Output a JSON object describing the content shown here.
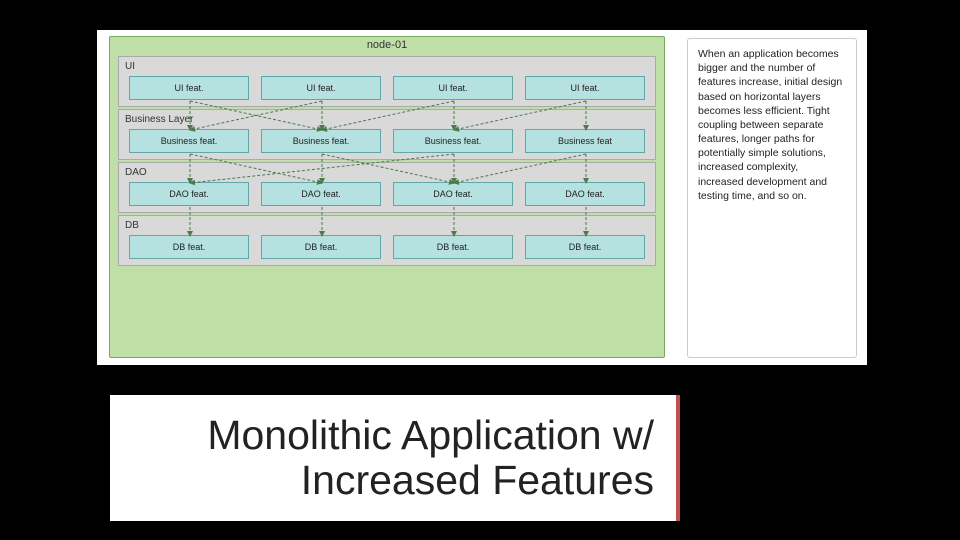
{
  "diagram": {
    "node_title": "node-01",
    "layers": [
      {
        "name": "UI",
        "features": [
          "UI feat.",
          "UI feat.",
          "UI feat.",
          "UI feat."
        ]
      },
      {
        "name": "Business Layer",
        "features": [
          "Business feat.",
          "Business feat.",
          "Business feat.",
          "Business feat"
        ]
      },
      {
        "name": "DAO",
        "features": [
          "DAO feat.",
          "DAO feat.",
          "DAO feat.",
          "DAO feat."
        ]
      },
      {
        "name": "DB",
        "features": [
          "DB feat.",
          "DB feat.",
          "DB feat.",
          "DB feat."
        ]
      }
    ]
  },
  "sidebar_text": "When an application becomes bigger and the number of features increase, initial design based on horizontal layers becomes less efficient. Tight coupling between separate features, longer paths for potentially simple solutions, increased complexity, increased development and testing time, and so on.",
  "title_line1": "Monolithic Application w/",
  "title_line2": "Increased Features",
  "arrows": [
    {
      "from_layer": 0,
      "from_col": 0,
      "to_layer": 1,
      "to_col": 0
    },
    {
      "from_layer": 0,
      "from_col": 0,
      "to_layer": 1,
      "to_col": 1
    },
    {
      "from_layer": 0,
      "from_col": 1,
      "to_layer": 1,
      "to_col": 1
    },
    {
      "from_layer": 0,
      "from_col": 1,
      "to_layer": 1,
      "to_col": 0
    },
    {
      "from_layer": 0,
      "from_col": 2,
      "to_layer": 1,
      "to_col": 2
    },
    {
      "from_layer": 0,
      "from_col": 2,
      "to_layer": 1,
      "to_col": 1
    },
    {
      "from_layer": 0,
      "from_col": 3,
      "to_layer": 1,
      "to_col": 3
    },
    {
      "from_layer": 0,
      "from_col": 3,
      "to_layer": 1,
      "to_col": 2
    },
    {
      "from_layer": 1,
      "from_col": 0,
      "to_layer": 2,
      "to_col": 0
    },
    {
      "from_layer": 1,
      "from_col": 0,
      "to_layer": 2,
      "to_col": 1
    },
    {
      "from_layer": 1,
      "from_col": 1,
      "to_layer": 2,
      "to_col": 1
    },
    {
      "from_layer": 1,
      "from_col": 1,
      "to_layer": 2,
      "to_col": 2
    },
    {
      "from_layer": 1,
      "from_col": 2,
      "to_layer": 2,
      "to_col": 2
    },
    {
      "from_layer": 1,
      "from_col": 2,
      "to_layer": 2,
      "to_col": 0
    },
    {
      "from_layer": 1,
      "from_col": 3,
      "to_layer": 2,
      "to_col": 3
    },
    {
      "from_layer": 1,
      "from_col": 3,
      "to_layer": 2,
      "to_col": 2
    },
    {
      "from_layer": 2,
      "from_col": 0,
      "to_layer": 3,
      "to_col": 0
    },
    {
      "from_layer": 2,
      "from_col": 1,
      "to_layer": 3,
      "to_col": 1
    },
    {
      "from_layer": 2,
      "from_col": 2,
      "to_layer": 3,
      "to_col": 2
    },
    {
      "from_layer": 2,
      "from_col": 3,
      "to_layer": 3,
      "to_col": 3
    }
  ]
}
